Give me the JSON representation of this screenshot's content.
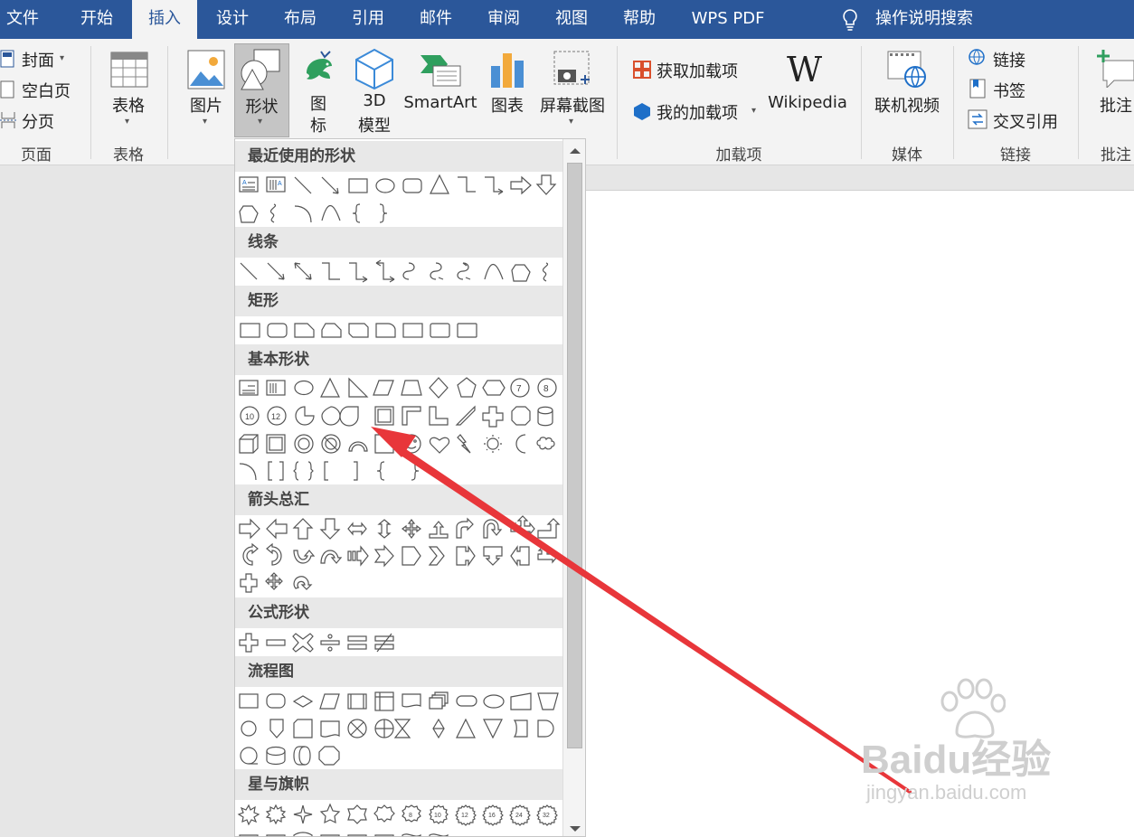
{
  "tabs": [
    {
      "label": "文件",
      "active": false
    },
    {
      "label": "开始",
      "active": false
    },
    {
      "label": "插入",
      "active": true
    },
    {
      "label": "设计",
      "active": false
    },
    {
      "label": "布局",
      "active": false
    },
    {
      "label": "引用",
      "active": false
    },
    {
      "label": "邮件",
      "active": false
    },
    {
      "label": "审阅",
      "active": false
    },
    {
      "label": "视图",
      "active": false
    },
    {
      "label": "帮助",
      "active": false
    },
    {
      "label": "WPS PDF",
      "active": false
    }
  ],
  "tell_me": "操作说明搜索",
  "ribbon": {
    "pages": {
      "cover": "封面",
      "blank": "空白页",
      "break": "分页",
      "group": "页面"
    },
    "table": {
      "label": "表格",
      "group": "表格"
    },
    "picture": "图片",
    "shapes": "形状",
    "icons_line1": "图",
    "icons_line2": "标",
    "model_line1": "3D",
    "model_line2": "模型",
    "smartart": "SmartArt",
    "chart": "图表",
    "screenshot": "屏幕截图",
    "addins": {
      "get": "获取加载项",
      "mine": "我的加载项",
      "wikipedia": "Wikipedia",
      "group": "加载项"
    },
    "media": {
      "video": "联机视频",
      "group": "媒体"
    },
    "links": {
      "link": "链接",
      "bookmark": "书签",
      "xref": "交叉引用",
      "group": "链接"
    },
    "comments": {
      "comment": "批注",
      "group": "批注"
    }
  },
  "dropdown": {
    "sections": [
      {
        "title": "最近使用的形状",
        "rows": 2
      },
      {
        "title": "线条",
        "rows": 1
      },
      {
        "title": "矩形",
        "rows": 1
      },
      {
        "title": "基本形状",
        "rows": 4
      },
      {
        "title": "箭头总汇",
        "rows": 3
      },
      {
        "title": "公式形状",
        "rows": 1
      },
      {
        "title": "流程图",
        "rows": 3
      },
      {
        "title": "星与旗帜",
        "rows": 2
      }
    ],
    "star_labels": [
      "8",
      "10",
      "12",
      "16",
      "24",
      "32"
    ],
    "octagon_labels": [
      "7",
      "8",
      "10",
      "12"
    ]
  },
  "watermark": {
    "brand": "Baidu经验",
    "url": "jingyan.baidu.com"
  },
  "colors": {
    "accent": "#2b579a",
    "arrow": "#e8363a"
  }
}
